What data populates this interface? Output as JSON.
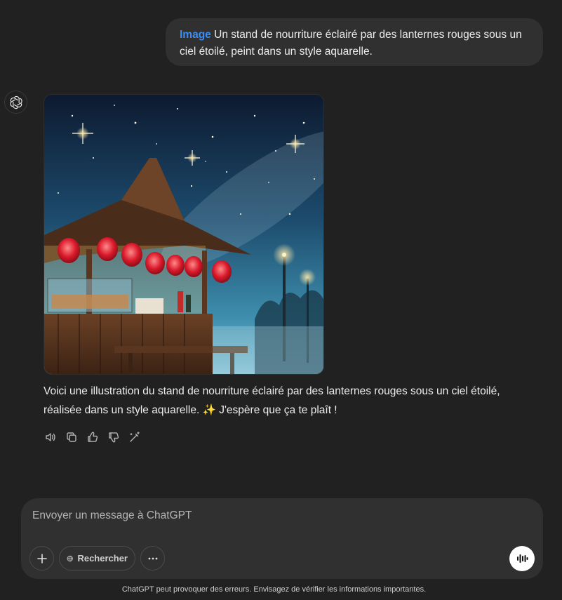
{
  "user_message": {
    "tag": "Image",
    "text": "Un stand de nourriture éclairé par des lanternes rouges sous un ciel étoilé, peint dans un style aquarelle."
  },
  "assistant": {
    "avatar_icon": "openai-logo-icon",
    "image_icon": "generated-watercolor-image",
    "reply_line1": "Voici une illustration du stand de nourriture éclairé par des lanternes rouges sous un ciel étoilé,",
    "reply_line2": "réalisée dans un style aquarelle. ✨ J'espère que ça te plaît !",
    "actions": [
      "read-aloud-icon",
      "copy-icon",
      "thumbs-up-icon",
      "thumbs-down-icon",
      "edit-wand-icon"
    ]
  },
  "composer": {
    "placeholder": "Envoyer un message à ChatGPT",
    "value": "",
    "search_label": "Rechercher"
  },
  "footer": {
    "disclaimer": "ChatGPT peut provoquer des erreurs. Envisagez de vérifier les informations importantes."
  },
  "colors": {
    "background": "#212121",
    "bubble": "#303030",
    "accent_tag": "#3b8cf4",
    "text": "#ececec"
  }
}
